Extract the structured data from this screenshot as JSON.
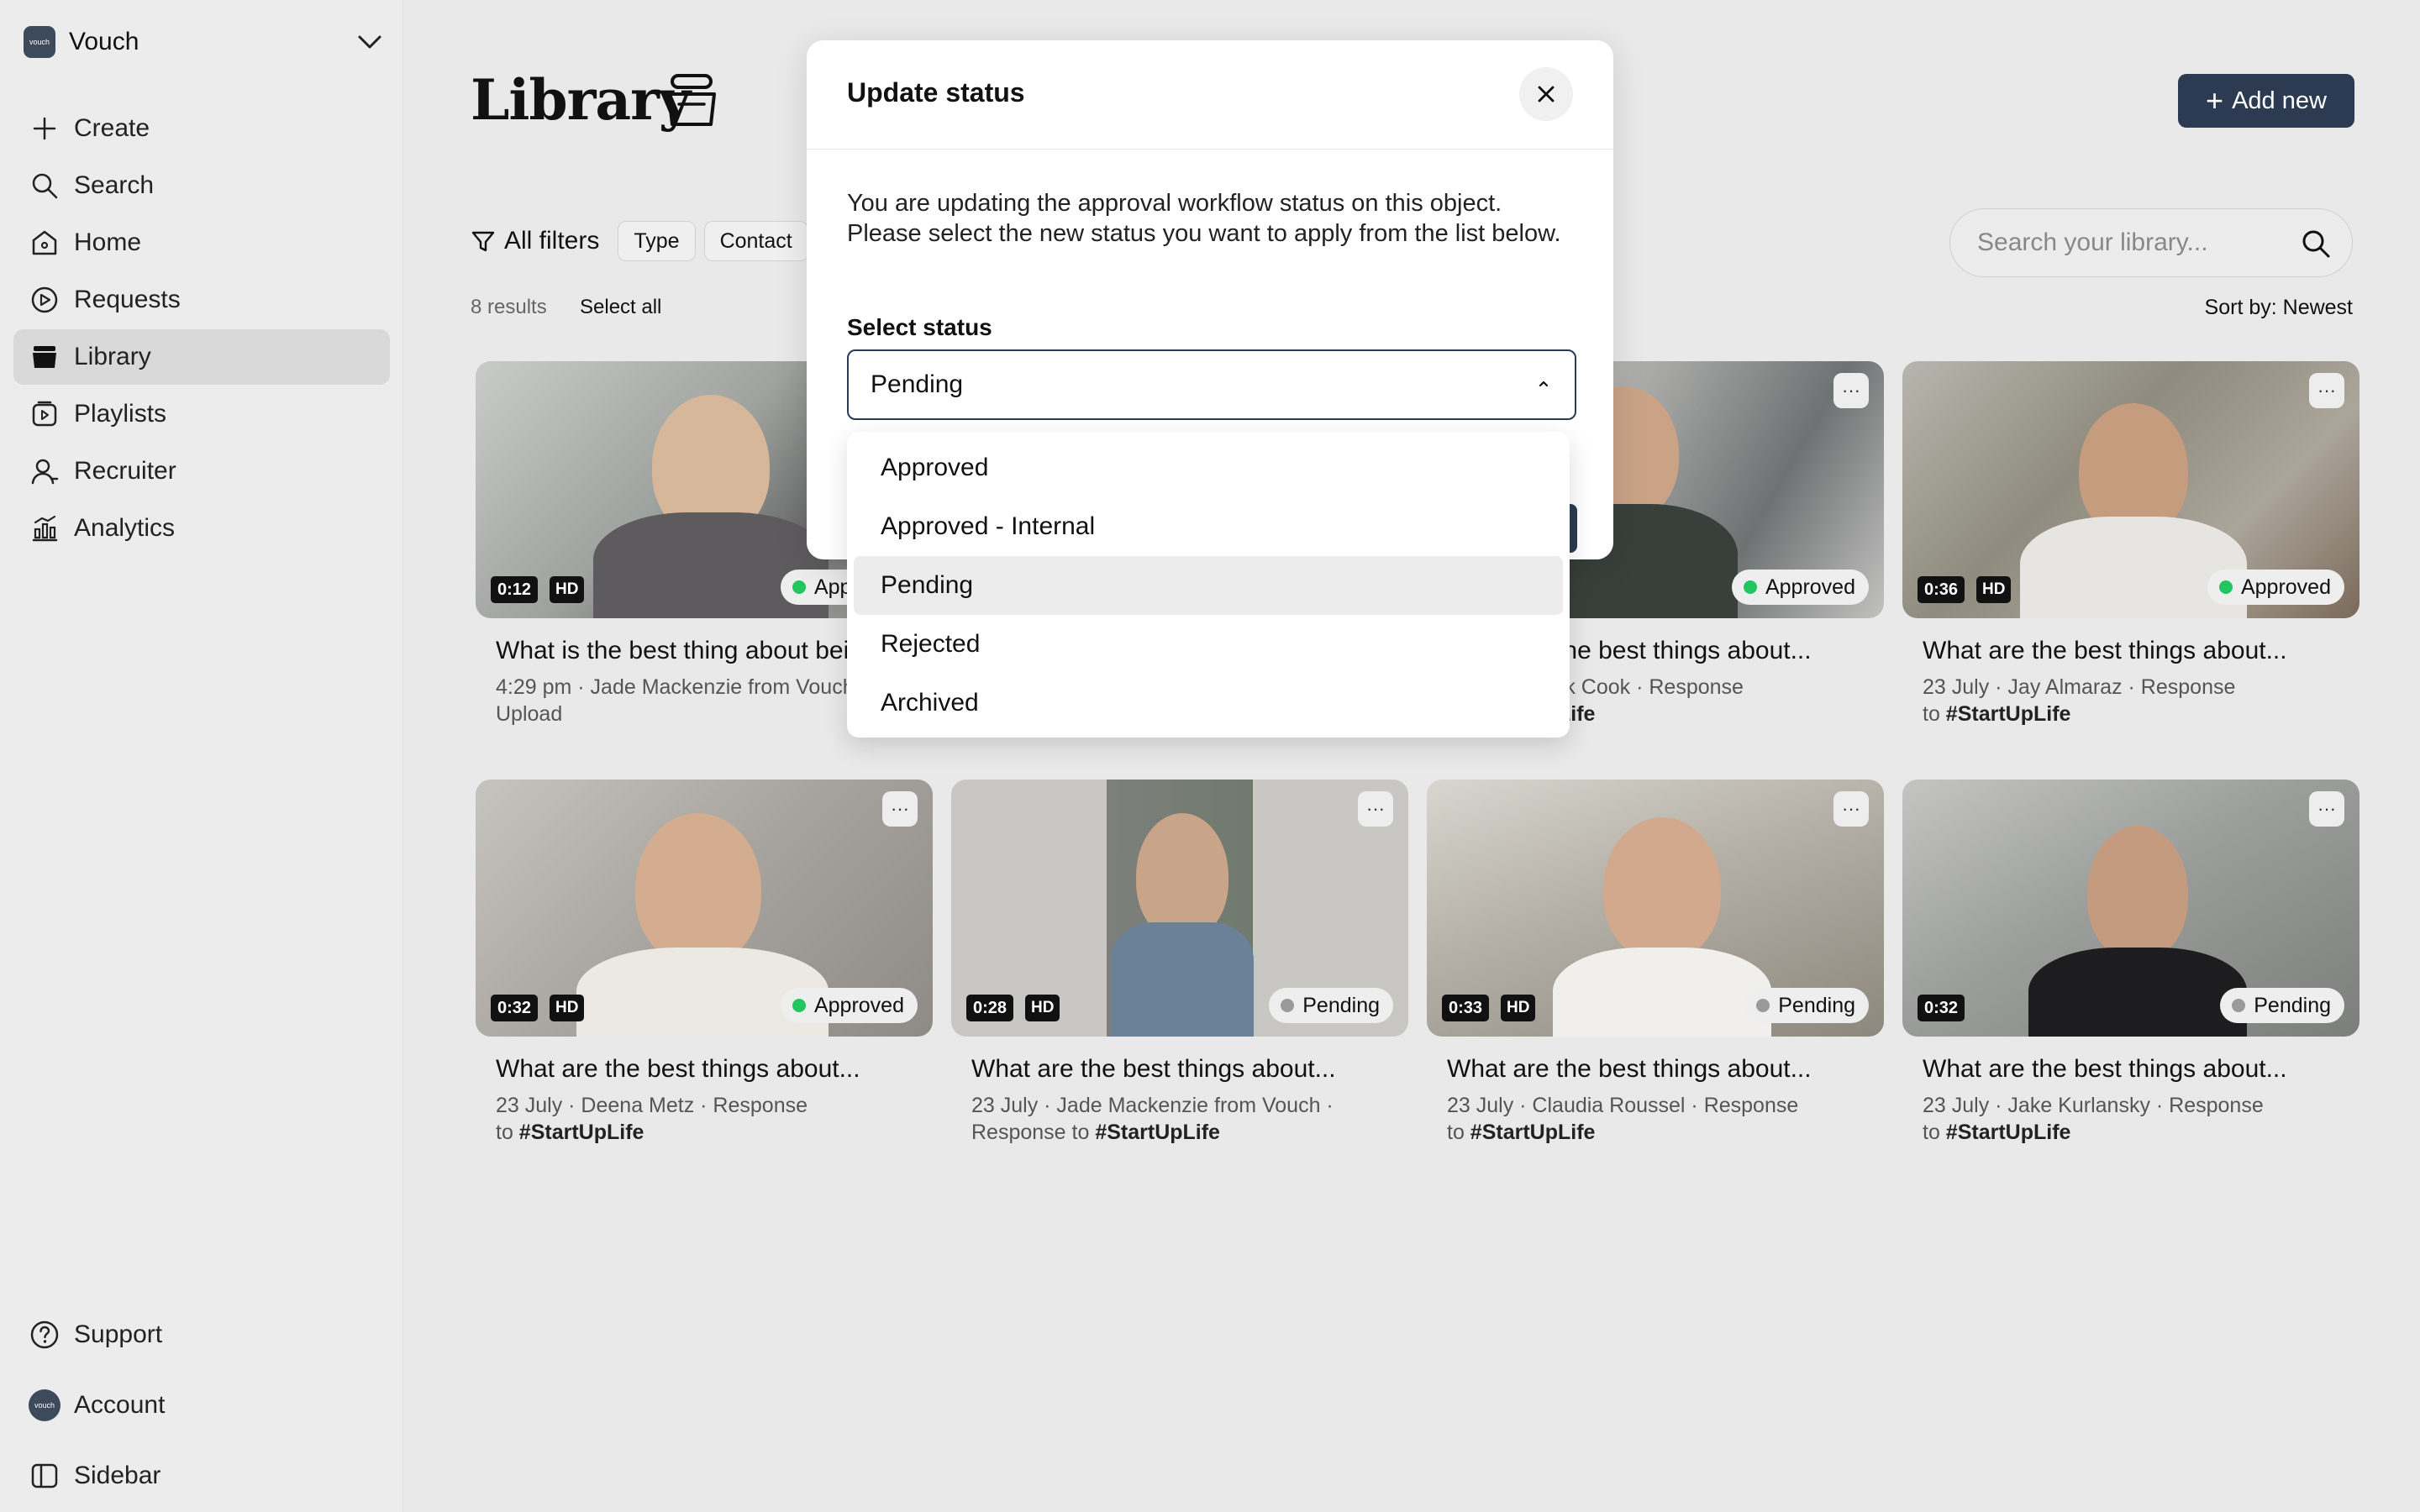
{
  "sidebar": {
    "workspace_name": "Vouch",
    "workspace_logo_text": "vouch",
    "items": [
      {
        "label": "Create",
        "icon": "plus-icon"
      },
      {
        "label": "Search",
        "icon": "search-icon"
      },
      {
        "label": "Home",
        "icon": "home-icon"
      },
      {
        "label": "Requests",
        "icon": "requests-icon"
      },
      {
        "label": "Library",
        "icon": "library-icon",
        "active": true
      },
      {
        "label": "Playlists",
        "icon": "playlists-icon"
      },
      {
        "label": "Recruiter",
        "icon": "recruiter-icon"
      },
      {
        "label": "Analytics",
        "icon": "analytics-icon"
      }
    ],
    "bottom_items": [
      {
        "label": "Support",
        "icon": "help-icon"
      },
      {
        "label": "Account",
        "icon": "avatar-icon"
      },
      {
        "label": "Sidebar",
        "icon": "sidebar-toggle-icon"
      }
    ]
  },
  "header": {
    "title": "Library",
    "add_new_label": "Add new"
  },
  "filters": {
    "all_filters_label": "All filters",
    "chips": [
      "Type",
      "Contact"
    ]
  },
  "search": {
    "placeholder": "Search your library..."
  },
  "results": {
    "count_label": "8 results",
    "select_all_label": "Select all",
    "sort_label": "Sort by: Newest"
  },
  "colors": {
    "accent": "#2c3b52",
    "approved": "#22c55e",
    "pending": "#9a9a9a"
  },
  "cards": [
    {
      "duration": "0:12",
      "hd": "HD",
      "status": "Approved",
      "title": "What is the best thing about being...",
      "meta_a": "4:29 pm · Jade Mackenzie from Vouch ·",
      "meta_b": "Upload",
      "meta_tag": ""
    },
    {
      "duration": "",
      "hd": "",
      "status": "",
      "title": "",
      "meta_a": "",
      "meta_b": "",
      "meta_tag": ""
    },
    {
      "duration": "",
      "hd": "",
      "status": "Approved",
      "title": "What are the best things about...",
      "meta_a": "23 July · Jack Cook · Response",
      "meta_b": "to ",
      "meta_tag": "#StartUpLife"
    },
    {
      "duration": "0:36",
      "hd": "HD",
      "status": "Approved",
      "title": "What are the best things about...",
      "meta_a": "23 July · Jay Almaraz · Response",
      "meta_b": "to ",
      "meta_tag": "#StartUpLife"
    },
    {
      "duration": "0:32",
      "hd": "HD",
      "status": "Approved",
      "title": "What are the best things about...",
      "meta_a": "23 July · Deena Metz · Response",
      "meta_b": "to ",
      "meta_tag": "#StartUpLife"
    },
    {
      "duration": "0:28",
      "hd": "HD",
      "status": "Pending",
      "title": "What are the best things about...",
      "meta_a": "23 July · Jade Mackenzie from Vouch ·",
      "meta_b": "Response to ",
      "meta_tag": "#StartUpLife"
    },
    {
      "duration": "0:33",
      "hd": "HD",
      "status": "Pending",
      "title": "What are the best things about...",
      "meta_a": "23 July · Claudia Roussel · Response",
      "meta_b": "to ",
      "meta_tag": "#StartUpLife"
    },
    {
      "duration": "0:32",
      "hd": "",
      "status": "Pending",
      "title": "What are the best things about...",
      "meta_a": "23 July · Jake Kurlansky · Response",
      "meta_b": "to ",
      "meta_tag": "#StartUpLife"
    }
  ],
  "modal": {
    "title": "Update status",
    "description": "You are updating the approval workflow status on this object. Please select the new status you want to apply from the list below.",
    "select_label": "Select status",
    "selected_value": "Pending",
    "options": [
      "Approved",
      "Approved - Internal",
      "Pending",
      "Rejected",
      "Archived"
    ]
  }
}
